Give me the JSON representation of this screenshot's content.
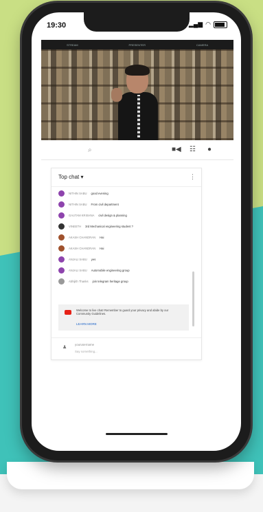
{
  "status_bar": {
    "time": "19:30"
  },
  "video": {
    "tabs": [
      "STREAM",
      "PRESENTER",
      "CAMERA"
    ]
  },
  "controls": {
    "search_icon": "search-icon",
    "icons": [
      "camera-icon",
      "grid-icon",
      "bell-icon"
    ]
  },
  "chat": {
    "title": "Top chat ▾",
    "messages": [
      {
        "author": "NITHIN SABU",
        "text": "good evening",
        "color": "#8e44ad"
      },
      {
        "author": "NITHIN SABU",
        "text": "From civil department",
        "color": "#8e44ad"
      },
      {
        "author": "GAUTAM KRISHNA",
        "text": "civil design & planning",
        "color": "#8e44ad"
      },
      {
        "author": "VINEETH",
        "text": "3rd Mechanical engineering student ?",
        "color": "#333333"
      },
      {
        "author": "AKASH CHANDRAN",
        "text": "Hai",
        "color": "#a0522d"
      },
      {
        "author": "AKASH CHANDRAN",
        "text": "Hai",
        "color": "#a0522d"
      },
      {
        "author": "ANJALI SABU",
        "text": "yes",
        "color": "#8e44ad"
      },
      {
        "author": "ANJALI SABU",
        "text": "Automobile engineering group",
        "color": "#8e44ad"
      },
      {
        "author": "Abhijith Thanks",
        "text": "join telegram heritage group",
        "color": "#999999"
      }
    ],
    "notice": {
      "text": "Welcome to live chat! Remember to guard your privacy and abide by our Community Guidelines.",
      "link": "LEARN MORE"
    },
    "input": {
      "name": "yourusername",
      "placeholder": "Say something..."
    }
  }
}
